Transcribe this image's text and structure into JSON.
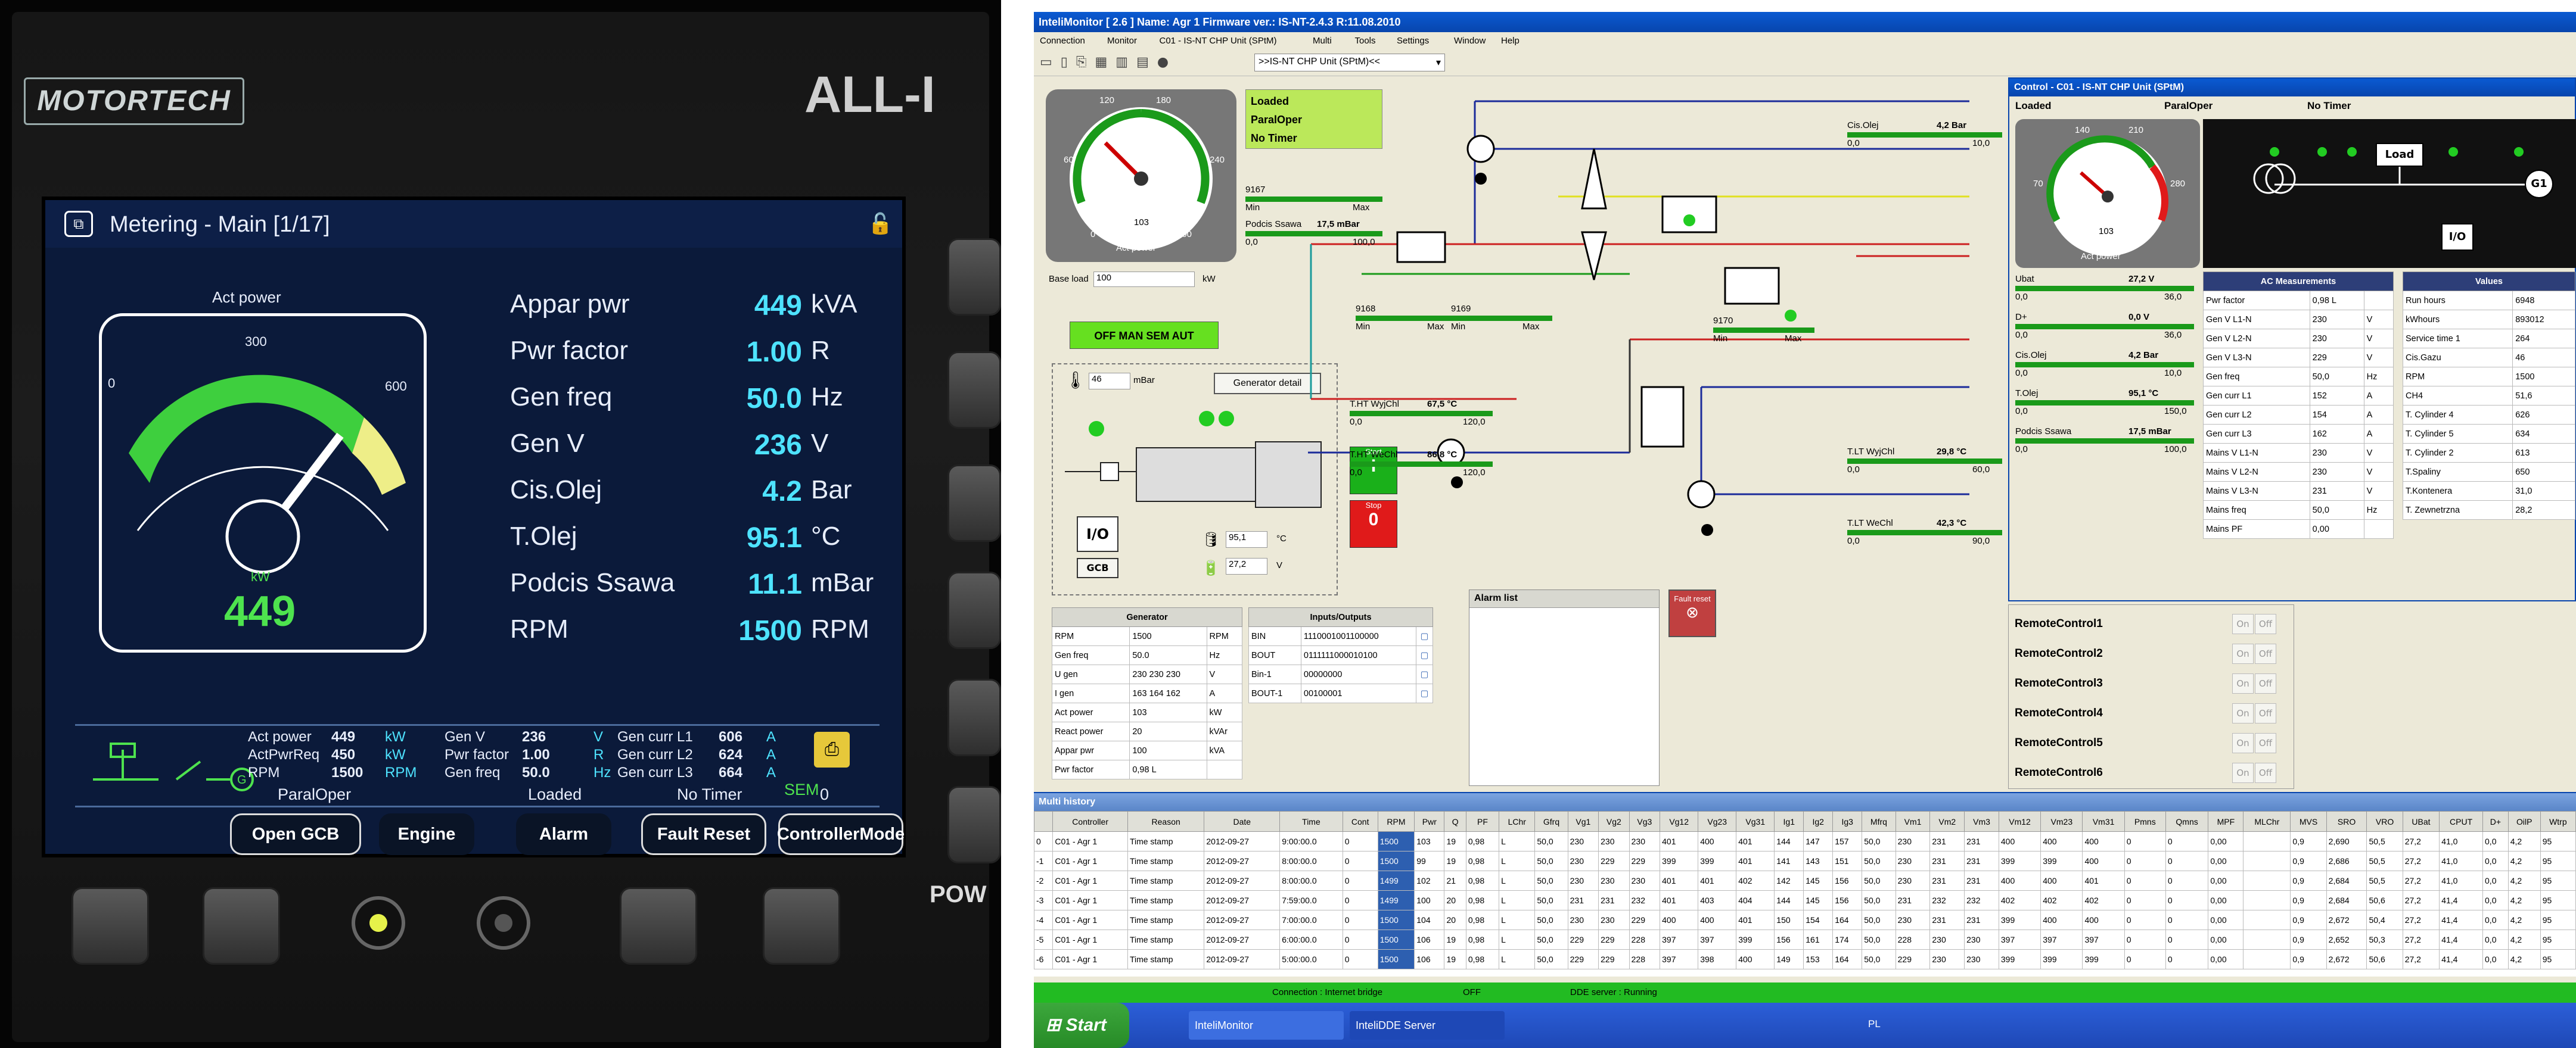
{
  "panel": {
    "brand": "MOTORTECH",
    "model": "ALL-I",
    "power_label": "POW",
    "screen_title": "Metering - Main [1/17]",
    "gauge": {
      "label": "Act power",
      "tick0": "0",
      "tick300": "300",
      "tick600": "600",
      "unit": "kW",
      "value": "449"
    },
    "metrics": [
      {
        "name": "Appar pwr",
        "value": "449",
        "unit": "kVA"
      },
      {
        "name": "Pwr factor",
        "value": "1.00",
        "unit": "R"
      },
      {
        "name": "Gen freq",
        "value": "50.0",
        "unit": "Hz"
      },
      {
        "name": "Gen V",
        "value": "236",
        "unit": "V"
      },
      {
        "name": "Cis.Olej",
        "value": "4.2",
        "unit": "Bar"
      },
      {
        "name": "T.Olej",
        "value": "95.1",
        "unit": "°C"
      },
      {
        "name": "Podcis Ssawa",
        "value": "11.1",
        "unit": "mBar"
      },
      {
        "name": "RPM",
        "value": "1500",
        "unit": "RPM"
      }
    ],
    "status": {
      "c1": [
        [
          "Act power",
          "449",
          "kW"
        ],
        [
          "ActPwrReq",
          "450",
          "kW"
        ],
        [
          "RPM",
          "1500",
          "RPM"
        ]
      ],
      "c2": [
        [
          "Gen V",
          "236",
          "V"
        ],
        [
          "Pwr factor",
          "1.00",
          "R"
        ],
        [
          "Gen freq",
          "50.0",
          "Hz"
        ]
      ],
      "c3": [
        [
          "Gen curr L1",
          "606",
          "A"
        ],
        [
          "Gen curr L2",
          "624",
          "A"
        ],
        [
          "Gen curr L3",
          "664",
          "A"
        ]
      ],
      "mode": "ParalOper",
      "loaded": "Loaded",
      "timer": "No Timer",
      "timer_val": "0",
      "sem": "SEM"
    },
    "softkeys": [
      "Open GCB",
      "Engine",
      "Alarm",
      "Fault Reset",
      "ControllerMode"
    ]
  },
  "app": {
    "title": "InteliMonitor [ 2.6 ] Name: Agr 1 Firmware ver.: IS-NT-2.4.3 R:11.08.2010",
    "menu": [
      "Connection",
      "Monitor",
      "C01 - IS-NT CHP Unit (SPtM)",
      "Multi",
      "Tools",
      "Settings",
      "Window",
      "Help"
    ],
    "toolbar_combo": ">>IS-NT CHP Unit (SPtM)<<",
    "main": {
      "gauge": {
        "t0": "0",
        "t120": "120",
        "t180": "180",
        "t240": "240",
        "t300": "300",
        "t60": "60",
        "value": "103",
        "unit": "kW",
        "label": "Act power"
      },
      "status_lines": [
        "Loaded",
        "ParalOper",
        "No Timer"
      ],
      "bars1": [
        {
          "name": "9167",
          "l": "Min",
          "r": "Max"
        },
        {
          "name": "Podcis Ssawa",
          "value": "17,5 mBar",
          "l": "0,0",
          "r": "100,0"
        }
      ],
      "base_load_label": "Base load",
      "base_load_value": "100",
      "base_load_unit": "kW",
      "mode_button": "OFF MAN SEM AUT",
      "temp_value": "46",
      "temp_unit": "mBar",
      "gen_detail": "Generator detail",
      "io": "I/O",
      "gcb": "GCB",
      "batt": [
        {
          "v": "95,1",
          "u": "°C"
        },
        {
          "v": "27,2",
          "u": "V"
        }
      ],
      "bars2": [
        {
          "name": "9168",
          "l": "Min",
          "r": "Max"
        },
        {
          "name": "9169",
          "l": "Min",
          "r": "Max"
        },
        {
          "name": "9170",
          "l": "Min",
          "r": "Max"
        }
      ],
      "cis_olej": {
        "name": "Cis.Olej",
        "value": "4,2 Bar",
        "l": "0,0",
        "r": "10,0"
      },
      "ht_wy": {
        "name": "T.HT WyjChl",
        "value": "67,5 °C",
        "l": "0,0",
        "r": "120,0"
      },
      "ht_we": {
        "name": "T.HT WeChl",
        "value": "86,8 °C",
        "l": "0,0",
        "r": "120,0"
      },
      "lt_wy": {
        "name": "T.LT WyjChl",
        "value": "29,8 °C",
        "l": "0,0",
        "r": "60,0"
      },
      "lt_we": {
        "name": "T.LT WeChl",
        "value": "42,3 °C",
        "l": "0,0",
        "r": "90,0"
      },
      "start": "Start",
      "start_sym": "I",
      "stop": "Stop",
      "stop_sym": "0",
      "gen_table": {
        "title": "Generator",
        "rows": [
          [
            "RPM",
            "1500",
            "RPM"
          ],
          [
            "Gen freq",
            "50.0",
            "Hz"
          ],
          [
            "U gen",
            "230 230 230",
            "V"
          ],
          [
            "I gen",
            "163 164 162",
            "A"
          ],
          [
            "Act power",
            "103",
            "kW"
          ],
          [
            "React power",
            "20",
            "kVAr"
          ],
          [
            "Appar pwr",
            "100",
            "kVA"
          ],
          [
            "Pwr factor",
            "0,98 L",
            ""
          ]
        ]
      },
      "io_table": {
        "title": "Inputs/Outputs",
        "rows": [
          [
            "BIN",
            "1110001001100000"
          ],
          [
            "BOUT",
            "0111111000010100"
          ],
          [
            "Bin-1",
            "00000000"
          ],
          [
            "BOUT-1",
            "00100001"
          ]
        ]
      },
      "alarm_list": "Alarm list",
      "fault_reset": "Fault reset"
    },
    "control": {
      "title": "Control - C01 - IS-NT CHP Unit (SPtM)",
      "status": [
        "Loaded",
        "ParalOper",
        "No Timer"
      ],
      "gauge": {
        "t0": "0",
        "t70": "70",
        "t140": "140",
        "t210": "210",
        "t280": "280",
        "value": "103",
        "unit": "kW",
        "label": "Act power"
      },
      "load": "Load",
      "g1": "G1",
      "io": "I/O",
      "bars": [
        {
          "name": "Ubat",
          "value": "27,2 V",
          "l": "0,0",
          "r": "36,0"
        },
        {
          "name": "D+",
          "value": "0,0 V",
          "l": "0,0",
          "r": "36,0"
        },
        {
          "name": "Cis.Olej",
          "value": "4,2 Bar",
          "l": "0,0",
          "r": "10,0"
        },
        {
          "name": "T.Olej",
          "value": "95,1 °C",
          "l": "0,0",
          "r": "150,0"
        },
        {
          "name": "Podcis Ssawa",
          "value": "17,5 mBar",
          "l": "0,0",
          "r": "100,0"
        }
      ],
      "ac_title": "AC Measurements",
      "ac_rows": [
        [
          "Pwr factor",
          "0,98 L",
          ""
        ],
        [
          "Gen V L1-N",
          "230",
          "V"
        ],
        [
          "Gen V L2-N",
          "230",
          "V"
        ],
        [
          "Gen V L3-N",
          "229",
          "V"
        ],
        [
          "Gen freq",
          "50,0",
          "Hz"
        ],
        [
          "Gen curr L1",
          "152",
          "A"
        ],
        [
          "Gen curr L2",
          "154",
          "A"
        ],
        [
          "Gen curr L3",
          "162",
          "A"
        ],
        [
          "Mains V L1-N",
          "230",
          "V"
        ],
        [
          "Mains V L2-N",
          "230",
          "V"
        ],
        [
          "Mains V L3-N",
          "231",
          "V"
        ],
        [
          "Mains freq",
          "50,0",
          "Hz"
        ],
        [
          "Mains PF",
          "0,00",
          ""
        ]
      ],
      "val_title": "Values",
      "val_rows": [
        [
          "Run hours",
          "6948"
        ],
        [
          "kWhours",
          "893012"
        ],
        [
          "Service time 1",
          "264"
        ],
        [
          "Cis.Gazu",
          "46"
        ],
        [
          "RPM",
          "1500"
        ],
        [
          "CH4",
          "51,6"
        ],
        [
          "T. Cylinder 4",
          "626"
        ],
        [
          "T. Cylinder 5",
          "634"
        ],
        [
          "T. Cylinder 2",
          "613"
        ],
        [
          "T.Spaliny",
          "650"
        ],
        [
          "T.Kontenera",
          "31,0"
        ],
        [
          "T. Zewnetrzna",
          "28,2"
        ]
      ],
      "remote": [
        "RemoteControl1",
        "RemoteControl2",
        "RemoteControl3",
        "RemoteControl4",
        "RemoteControl5",
        "RemoteControl6"
      ],
      "on": "On",
      "off": "Off"
    },
    "history": {
      "title": "Multi history",
      "cols": [
        "Controller",
        "Reason",
        "Date",
        "Time",
        "Cont",
        "RPM",
        "Pwr",
        "Q",
        "PF",
        "LChr",
        "Gfrq",
        "Vg1",
        "Vg2",
        "Vg3",
        "Vg12",
        "Vg23",
        "Vg31",
        "Ig1",
        "Ig2",
        "Ig3",
        "Mfrq",
        "Vm1",
        "Vm2",
        "Vm3",
        "Vm12",
        "Vm23",
        "Vm31",
        "Pmns",
        "Qmns",
        "MPF",
        "MLChr",
        "MVS",
        "SRO",
        "VRO",
        "UBat",
        "CPUT",
        "D+",
        "OilP",
        "Wtrp"
      ],
      "rows": [
        [
          "0",
          "C01 - Agr 1",
          "Time stamp",
          "2012-09-27",
          "9:00:00.0",
          "0",
          "1500",
          "103",
          "19",
          "0,98",
          "L",
          "50,0",
          "230",
          "230",
          "230",
          "401",
          "400",
          "401",
          "144",
          "147",
          "157",
          "50,0",
          "230",
          "231",
          "231",
          "400",
          "400",
          "400",
          "0",
          "0",
          "0,00",
          "",
          "0,9",
          "2,690",
          "50,5",
          "27,2",
          "41,0",
          "0,0",
          "4,2",
          "95"
        ],
        [
          "-1",
          "C01 - Agr 1",
          "Time stamp",
          "2012-09-27",
          "8:00:00.0",
          "0",
          "1500",
          "99",
          "19",
          "0,98",
          "L",
          "50,0",
          "230",
          "229",
          "229",
          "399",
          "399",
          "401",
          "141",
          "143",
          "151",
          "50,0",
          "230",
          "231",
          "231",
          "399",
          "399",
          "400",
          "0",
          "0",
          "0,00",
          "",
          "0,9",
          "2,686",
          "50,5",
          "27,2",
          "41,0",
          "0,0",
          "4,2",
          "95"
        ],
        [
          "-2",
          "C01 - Agr 1",
          "Time stamp",
          "2012-09-27",
          "8:00:00.0",
          "0",
          "1499",
          "102",
          "21",
          "0,98",
          "L",
          "50,0",
          "230",
          "230",
          "230",
          "401",
          "401",
          "402",
          "142",
          "145",
          "156",
          "50,0",
          "230",
          "231",
          "231",
          "400",
          "400",
          "401",
          "0",
          "0",
          "0,00",
          "",
          "0,9",
          "2,684",
          "50,5",
          "27,2",
          "41,0",
          "0,0",
          "4,2",
          "95"
        ],
        [
          "-3",
          "C01 - Agr 1",
          "Time stamp",
          "2012-09-27",
          "7:59:00.0",
          "0",
          "1499",
          "100",
          "20",
          "0,98",
          "L",
          "50,0",
          "231",
          "231",
          "232",
          "401",
          "403",
          "404",
          "144",
          "145",
          "156",
          "50,0",
          "231",
          "232",
          "232",
          "402",
          "402",
          "402",
          "0",
          "0",
          "0,00",
          "",
          "0,9",
          "2,684",
          "50,6",
          "27,2",
          "41,4",
          "0,0",
          "4,2",
          "95"
        ],
        [
          "-4",
          "C01 - Agr 1",
          "Time stamp",
          "2012-09-27",
          "7:00:00.0",
          "0",
          "1500",
          "104",
          "20",
          "0,98",
          "L",
          "50,0",
          "230",
          "230",
          "229",
          "400",
          "400",
          "401",
          "150",
          "154",
          "164",
          "50,0",
          "230",
          "231",
          "231",
          "399",
          "400",
          "400",
          "0",
          "0",
          "0,00",
          "",
          "0,9",
          "2,672",
          "50,4",
          "27,2",
          "41,4",
          "0,0",
          "4,2",
          "95"
        ],
        [
          "-5",
          "C01 - Agr 1",
          "Time stamp",
          "2012-09-27",
          "6:00:00.0",
          "0",
          "1500",
          "106",
          "19",
          "0,98",
          "L",
          "50,0",
          "229",
          "229",
          "228",
          "397",
          "397",
          "399",
          "156",
          "161",
          "174",
          "50,0",
          "228",
          "230",
          "230",
          "397",
          "397",
          "397",
          "0",
          "0",
          "0,00",
          "",
          "0,9",
          "2,652",
          "50,3",
          "27,2",
          "41,4",
          "0,0",
          "4,2",
          "95"
        ],
        [
          "-6",
          "C01 - Agr 1",
          "Time stamp",
          "2012-09-27",
          "5:00:00.0",
          "0",
          "1500",
          "106",
          "19",
          "0,98",
          "L",
          "50,0",
          "229",
          "229",
          "228",
          "397",
          "398",
          "400",
          "149",
          "153",
          "164",
          "50,0",
          "229",
          "230",
          "230",
          "399",
          "399",
          "399",
          "0",
          "0",
          "0,00",
          "",
          "0,9",
          "2,672",
          "50,6",
          "27,2",
          "41,4",
          "0,0",
          "4,2",
          "95"
        ]
      ]
    },
    "statusbar": [
      "Connection : Internet bridge",
      "OFF",
      "DDE server : Running"
    ],
    "taskbar": {
      "start": "Start",
      "items": [
        "InteliMonitor",
        "InteliDDE Server"
      ],
      "lang": "PL"
    }
  }
}
